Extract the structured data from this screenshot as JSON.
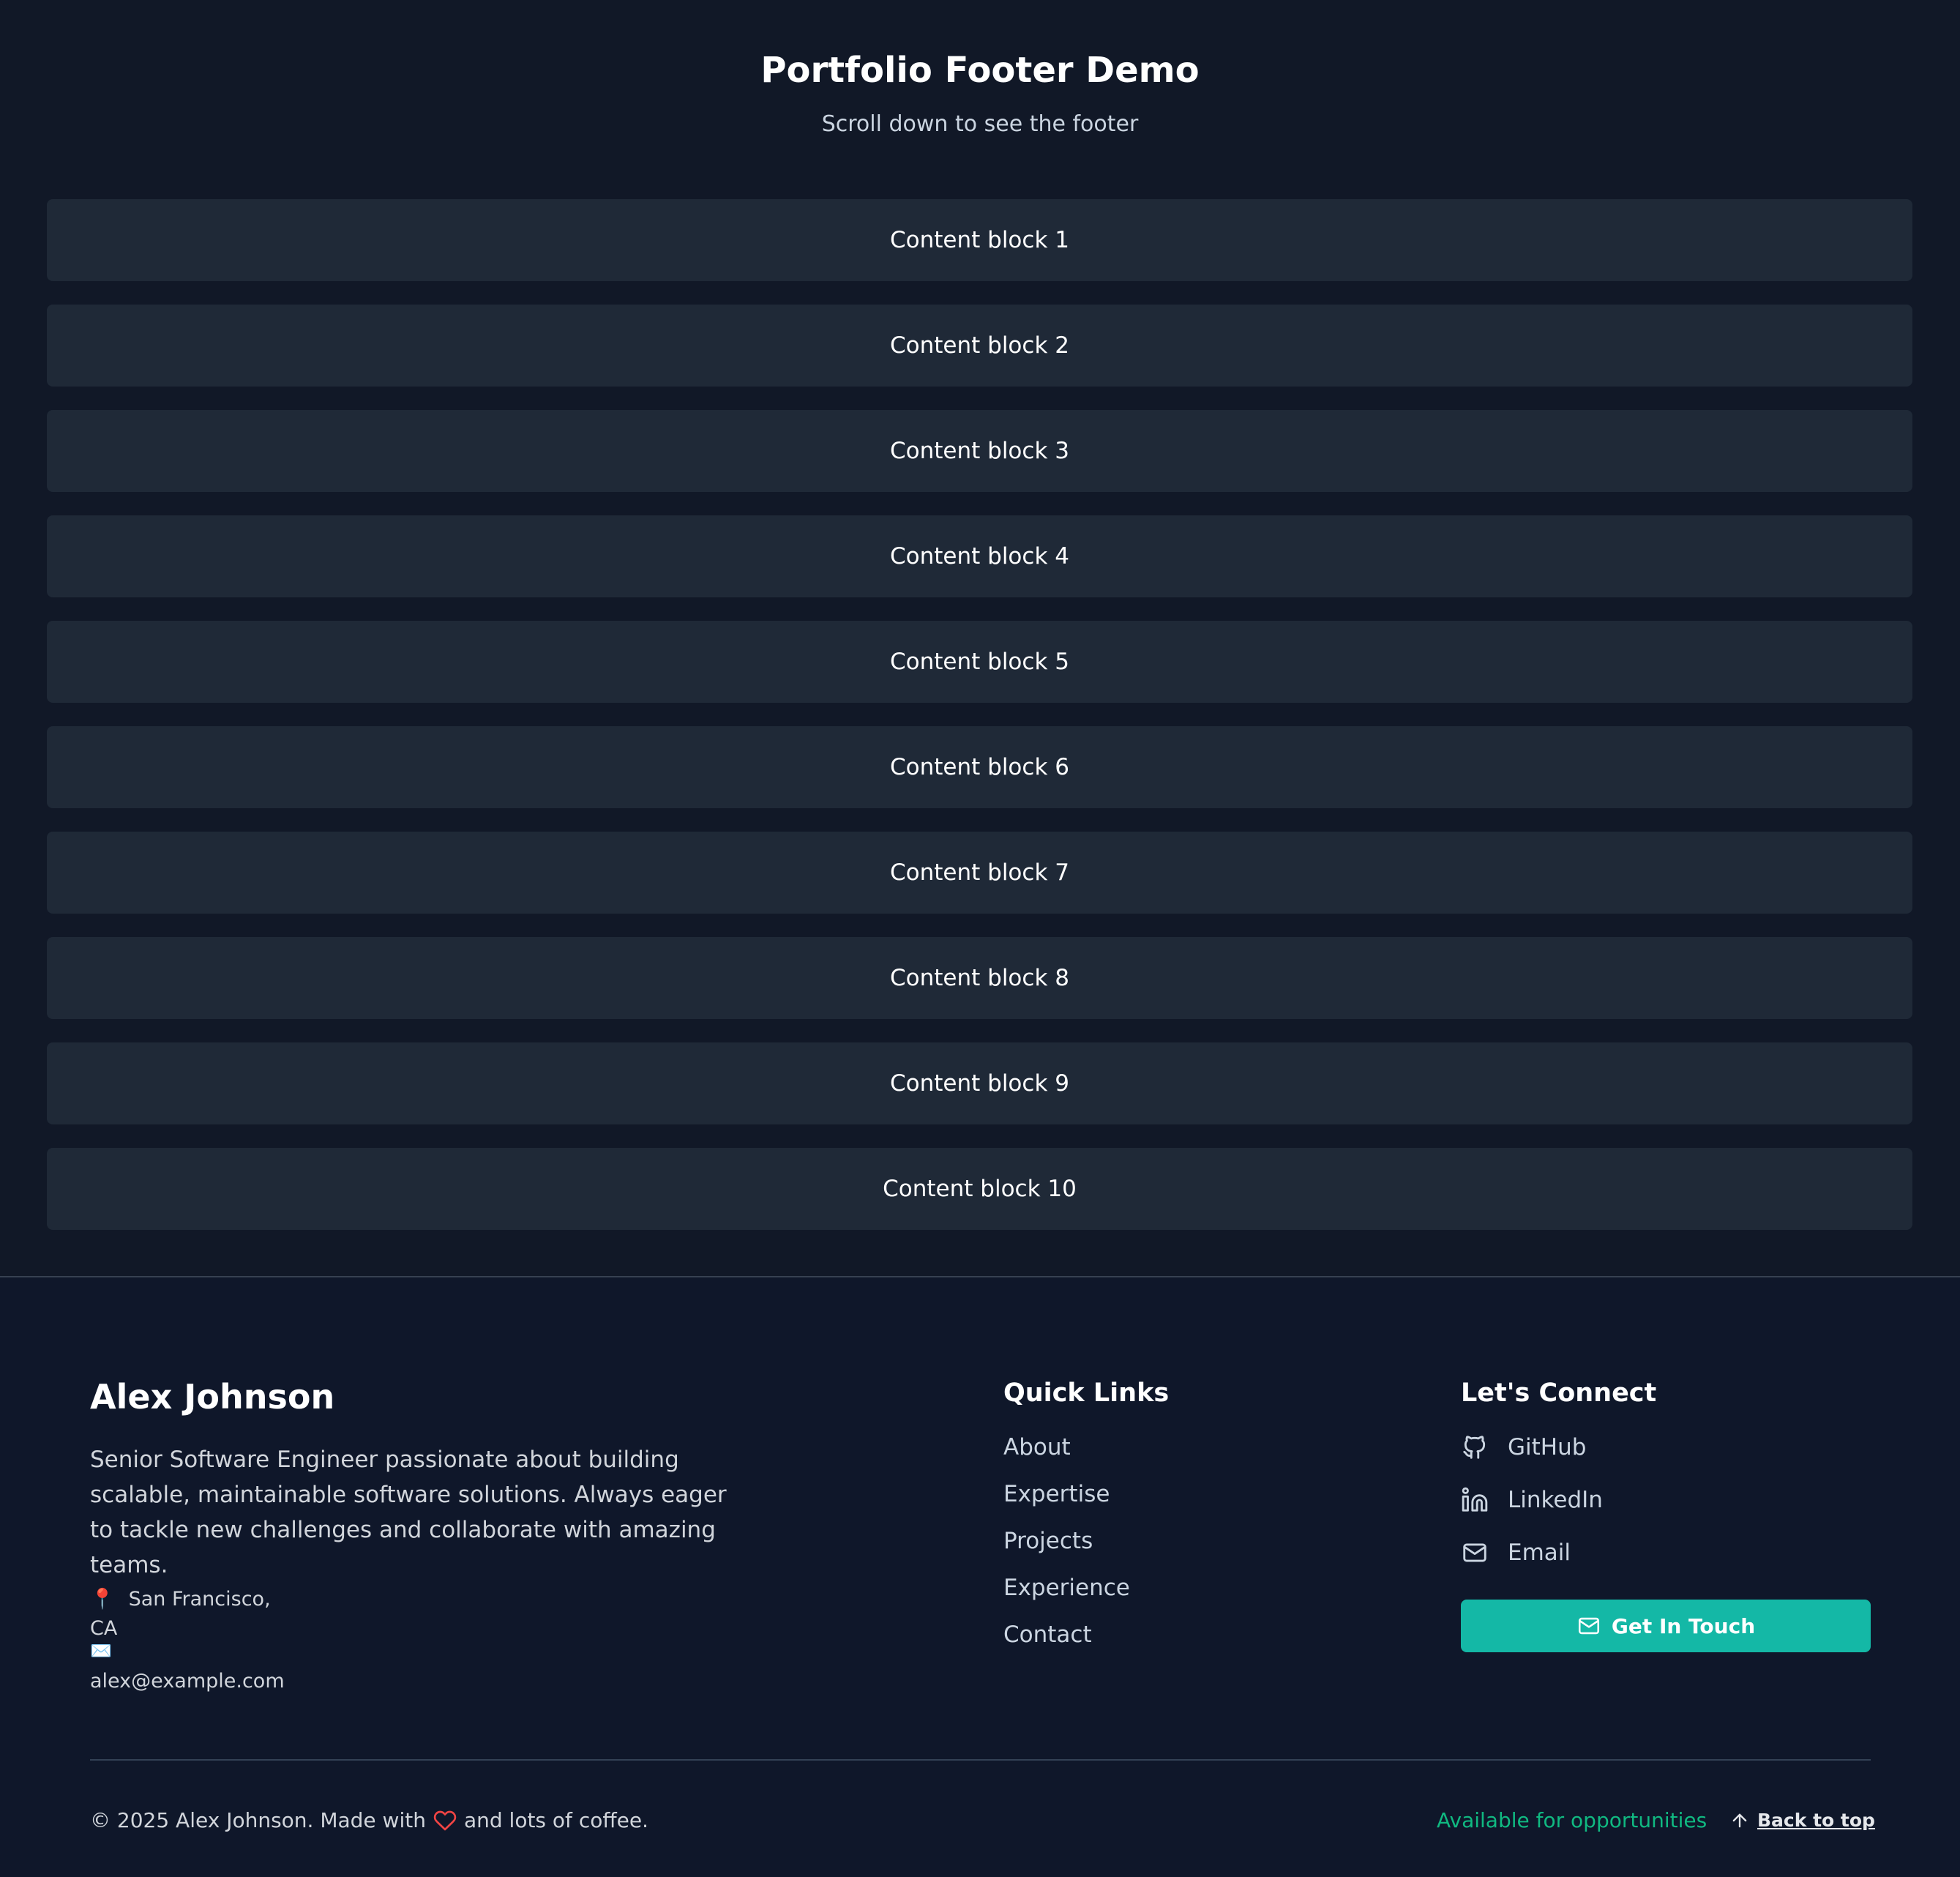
{
  "intro": {
    "title": "Portfolio Footer Demo",
    "subtitle": "Scroll down to see the footer"
  },
  "content_blocks": [
    "Content block 1",
    "Content block 2",
    "Content block 3",
    "Content block 4",
    "Content block 5",
    "Content block 6",
    "Content block 7",
    "Content block 8",
    "Content block 9",
    "Content block 10"
  ],
  "footer": {
    "name": "Alex Johnson",
    "bio": "Senior Software Engineer passionate about building scalable, maintainable software solutions. Always eager to tackle new challenges and collaborate with amazing teams.",
    "location_line_1": "San Francisco,",
    "location_line_2": "CA",
    "email_address": "alex@example.com",
    "quick_links_heading": "Quick Links",
    "quick_links": [
      "About",
      "Expertise",
      "Projects",
      "Experience",
      "Contact"
    ],
    "connect_heading": "Let's Connect",
    "socials": [
      {
        "label": "GitHub",
        "icon": "github-icon"
      },
      {
        "label": "LinkedIn",
        "icon": "linkedin-icon"
      },
      {
        "label": "Email",
        "icon": "mail-icon"
      }
    ],
    "cta_label": "Get In Touch",
    "copyright_before_heart": "© 2025 Alex Johnson. Made with",
    "copyright_after_heart": "and lots of coffee.",
    "availability": "Available for opportunities",
    "back_to_top": "Back to top",
    "location_icon": "map-pin-icon",
    "envelope_icon": "envelope-icon",
    "heart_icon": "heart-icon",
    "up_arrow_icon": "arrow-up-icon"
  },
  "colors": {
    "page_background": "#111827",
    "footer_background": "#0f172a",
    "content_block": "#1f2937",
    "accent": "#14b8a6",
    "availability": "#10b981",
    "heart": "#ef4444"
  }
}
